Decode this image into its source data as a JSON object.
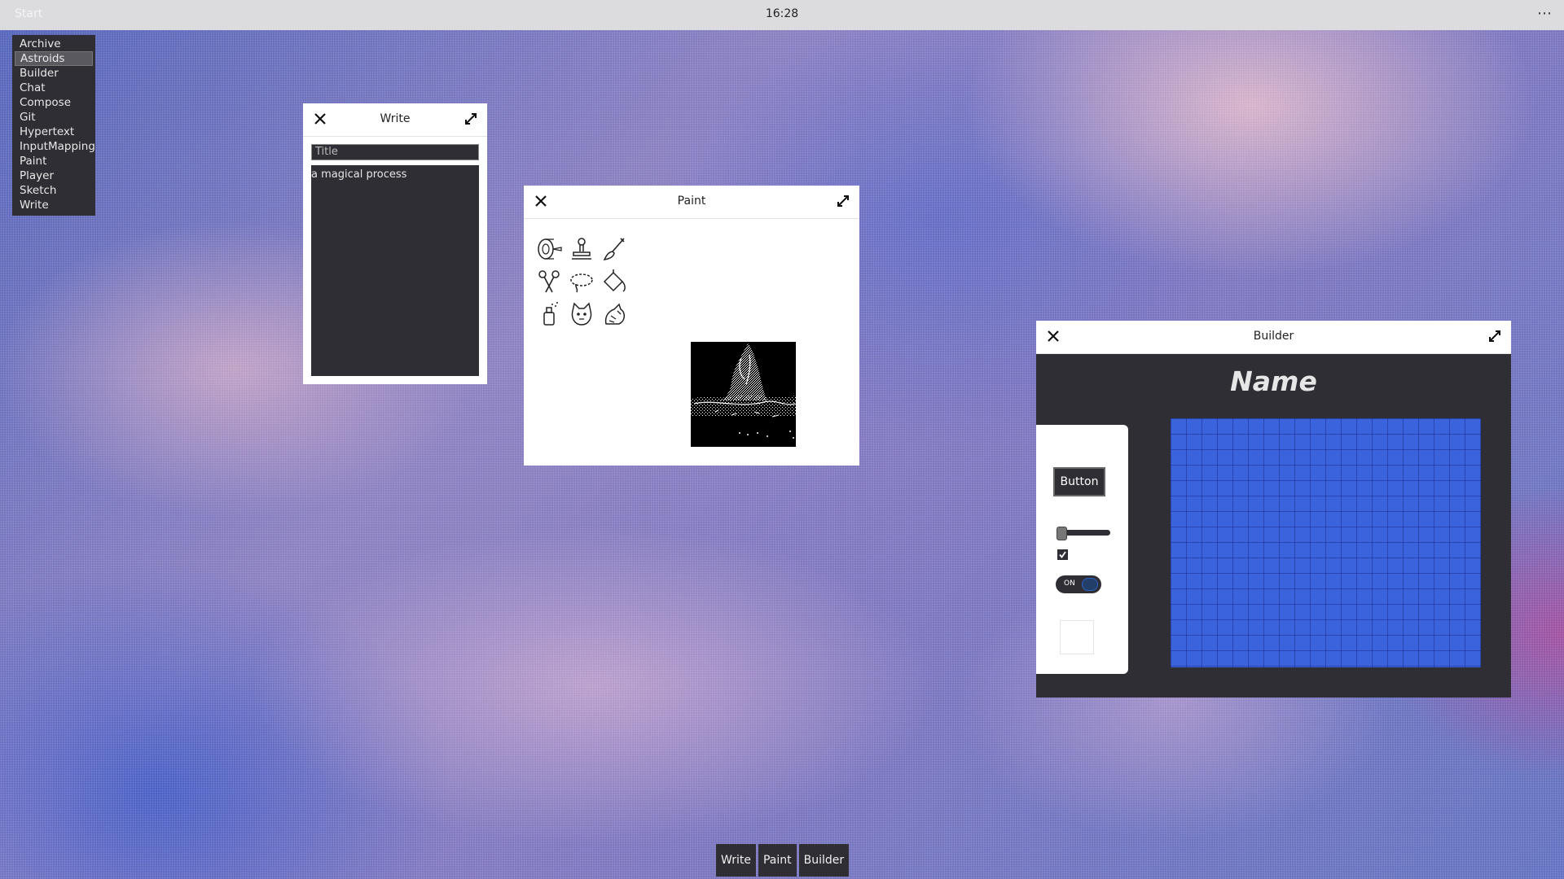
{
  "topbar": {
    "start_label": "Start",
    "clock": "16:28",
    "more_icon": "more-dots-icon"
  },
  "start_menu": {
    "items": [
      {
        "label": "Archive"
      },
      {
        "label": "Astroids",
        "selected": true
      },
      {
        "label": "Builder"
      },
      {
        "label": "Chat"
      },
      {
        "label": "Compose"
      },
      {
        "label": "Git"
      },
      {
        "label": "Hypertext"
      },
      {
        "label": "InputMapping"
      },
      {
        "label": "Paint"
      },
      {
        "label": "Player"
      },
      {
        "label": "Sketch"
      },
      {
        "label": "Write"
      }
    ]
  },
  "windows": {
    "write": {
      "title": "Write",
      "title_field_placeholder": "Title",
      "body_text": "a magical process"
    },
    "paint": {
      "title": "Paint",
      "tools": [
        "tape-roll-icon",
        "stamp-icon",
        "brush-icon",
        "scissors-icon",
        "lasso-icon",
        "fill-bucket-icon",
        "spray-icon",
        "cat-icon",
        "dragon-icon"
      ]
    },
    "builder": {
      "title": "Builder",
      "name_heading": "Name",
      "button_label": "Button",
      "slider_value": 0.0,
      "checkbox_checked": true,
      "toggle_label": "ON",
      "toggle_on": true
    }
  },
  "taskbar": {
    "items": [
      "Write",
      "Paint",
      "Builder"
    ]
  },
  "colors": {
    "panel_dark": "#2f2e34",
    "grid_blue": "#3b63dc"
  }
}
